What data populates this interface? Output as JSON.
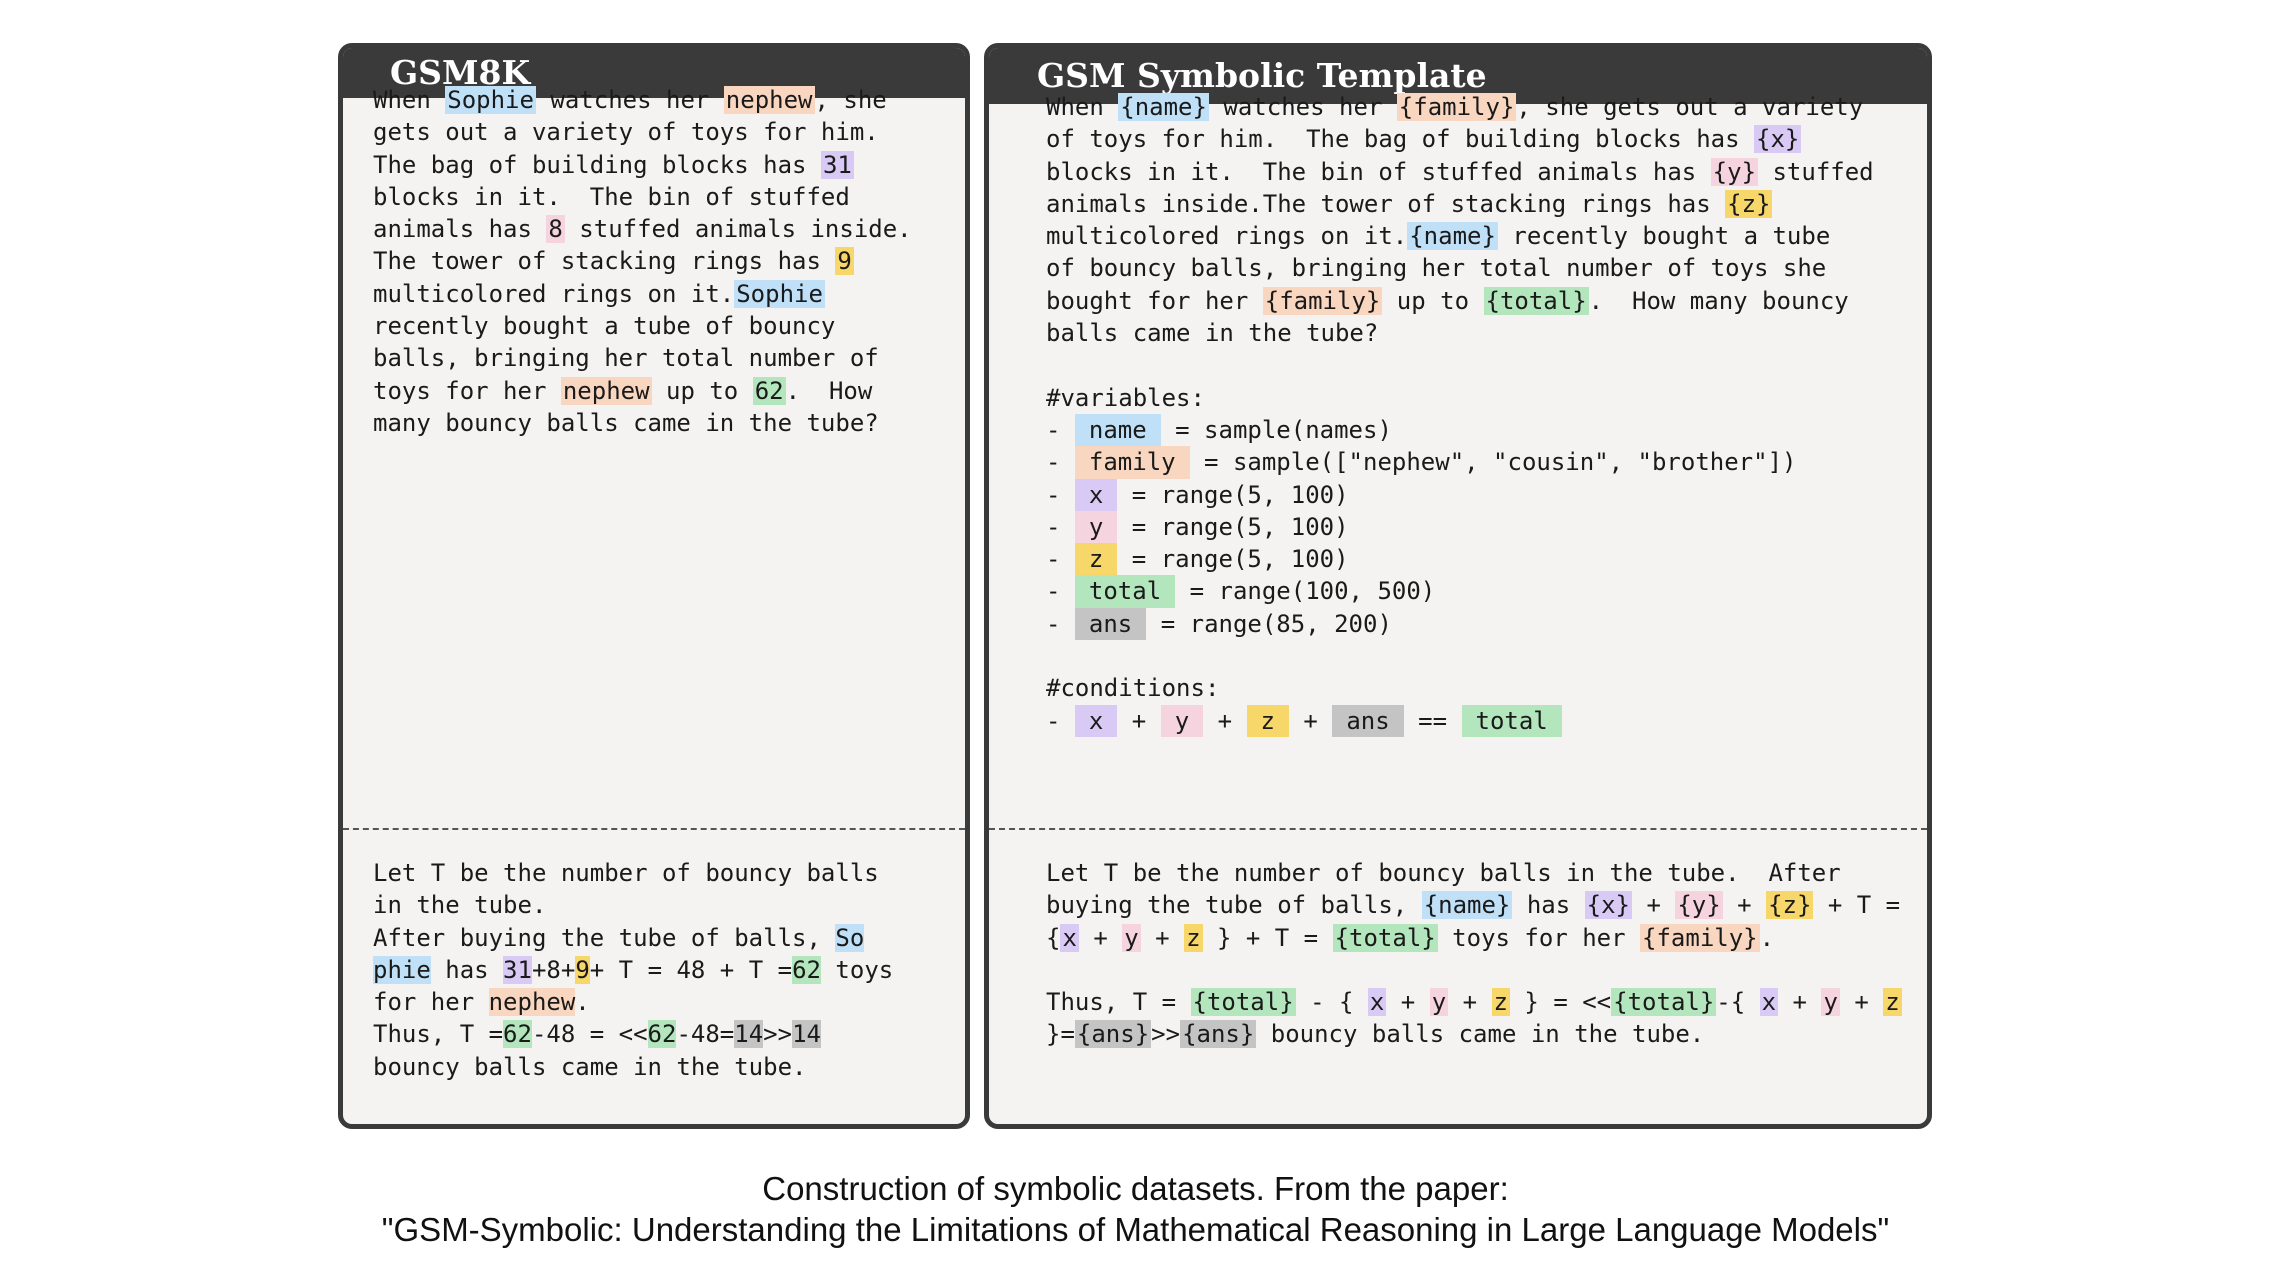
{
  "left_panel": {
    "title": "GSM8K",
    "q": {
      "a1": "When ",
      "name1": "Sophie",
      "a2": " watches her ",
      "fam1": "nephew",
      "a3": ", she",
      "l2": "gets out a variety of toys for him.",
      "l3a": "The bag of building blocks has ",
      "x": "31",
      "l4": "blocks in it.  The bin of stuffed",
      "l5a": "animals has ",
      "y": "8",
      "l5b": " stuffed animals inside.",
      "l6a": "The tower of stacking rings has ",
      "z": "9",
      "l7a": "multicolored rings on it.",
      "name2": "Sophie",
      "l8": "recently bought a tube of bouncy",
      "l9": "balls, bringing her total number of",
      "l10a": "toys for her ",
      "fam2": "nephew",
      "l10b": " up to ",
      "total": "62",
      "l10c": ".  How",
      "l11": "many bouncy balls came in the tube?"
    },
    "s": {
      "l1": "Let T be the number of bouncy balls",
      "l2": "in the tube.",
      "l3a": "After buying the tube of balls, ",
      "name_a": "So",
      "name_b": "phie",
      "l4a": " has ",
      "x": "31",
      "l4b": "+8+",
      "z": "9",
      "l4c": "+ T = 48 + T =",
      "total": "62",
      "l4d": " toys",
      "l5a": "for her ",
      "fam": "nephew",
      "l5b": ".",
      "l6a": "Thus, T =",
      "t1": "62",
      "l6b": "-48 = <<",
      "t2": "62",
      "l6c": "-48=",
      "a1": "14",
      "l6d": ">>",
      "a2": "14",
      "l7": "bouncy balls came in the tube."
    }
  },
  "right_panel": {
    "title": "GSM Symbolic Template",
    "q": {
      "a1": "When ",
      "name1": "{name}",
      "a2": " watches her ",
      "fam1": "{family}",
      "a3": ", she gets out a variety",
      "l2a": "of toys for him.  The bag of building blocks has ",
      "x": "{x}",
      "l3a": "blocks in it.  The bin of stuffed animals has ",
      "y": "{y}",
      "l3b": " stuffed",
      "l4a": "animals inside.The tower of stacking rings has ",
      "z": "{z}",
      "l5a": "multicolored rings on it.",
      "name2": "{name}",
      "l5b": " recently bought a tube",
      "l6": "of bouncy balls, bringing her total number of toys she",
      "l7a": "bought for her ",
      "fam2": "{family}",
      "l7b": " up to ",
      "total": "{total}",
      "l7c": ".  How many bouncy",
      "l8": "balls came in the tube?"
    },
    "variables_header": "#variables:",
    "variables": [
      {
        "dash": "- ",
        "name": "name",
        "expr": " = sample(names)"
      },
      {
        "dash": "- ",
        "name": "family",
        "expr": " = sample([\"nephew\", \"cousin\", \"brother\"])"
      },
      {
        "dash": "- ",
        "name": "x",
        "expr": " = range(5, 100)"
      },
      {
        "dash": "- ",
        "name": "y",
        "expr": " = range(5, 100)"
      },
      {
        "dash": "- ",
        "name": "z",
        "expr": " = range(5, 100)"
      },
      {
        "dash": "- ",
        "name": "total",
        "expr": " = range(100, 500)"
      },
      {
        "dash": "- ",
        "name": "ans",
        "expr": " = range(85, 200)"
      }
    ],
    "conditions_header": "#conditions:",
    "conditions": {
      "dash": "- ",
      "x": "x",
      "p1": " + ",
      "y": "y",
      "p2": " + ",
      "z": "z",
      "p3": " + ",
      "ans": "ans",
      "eq": " == ",
      "total": "total"
    },
    "s": {
      "l1": "Let T be the number of bouncy balls in the tube.  After",
      "l2a": "buying the tube of balls, ",
      "name": "{name}",
      "l2b": " has ",
      "x": "{x}",
      "l2c": " + ",
      "y": "{y}",
      "l2d": " + ",
      "z": "{z}",
      "l2e": " + T =",
      "l3a": "{",
      "x2": "x",
      "l3b": " + ",
      "y2": "y",
      "l3c": " + ",
      "z2": "z",
      "l3d": " } + T = ",
      "total": "{total}",
      "l3e": " toys for her ",
      "fam": "{family}",
      "l3f": ".",
      "l5a": "Thus, T = ",
      "t1": "{total}",
      "l5b": " - { ",
      "x3": "x",
      "l5c": " + ",
      "y3": "y",
      "l5d": " + ",
      "z3": "z",
      "l5e": " } = <<",
      "t2": "{total}",
      "l5f": "-{ ",
      "x4": "x",
      "l5g": " + ",
      "y4": "y",
      "l5h": " + ",
      "z4": "z",
      "l6a": "}=",
      "a1": "{ans}",
      "l6b": ">>",
      "a2": "{ans}",
      "l6c": " bouncy balls came in the tube."
    }
  },
  "caption": {
    "line1": "Construction of symbolic datasets. From the paper:",
    "line2": "\"GSM-Symbolic: Understanding the Limitations of Mathematical Reasoning in Large Language Models\""
  },
  "highlight_colors": {
    "name": "#bfe0f7",
    "family": "#f9d6c0",
    "x": "#d9c9f5",
    "y": "#f6d4df",
    "z": "#f7d66a",
    "total": "#b3e6bd",
    "ans": "#c4c4c4"
  }
}
